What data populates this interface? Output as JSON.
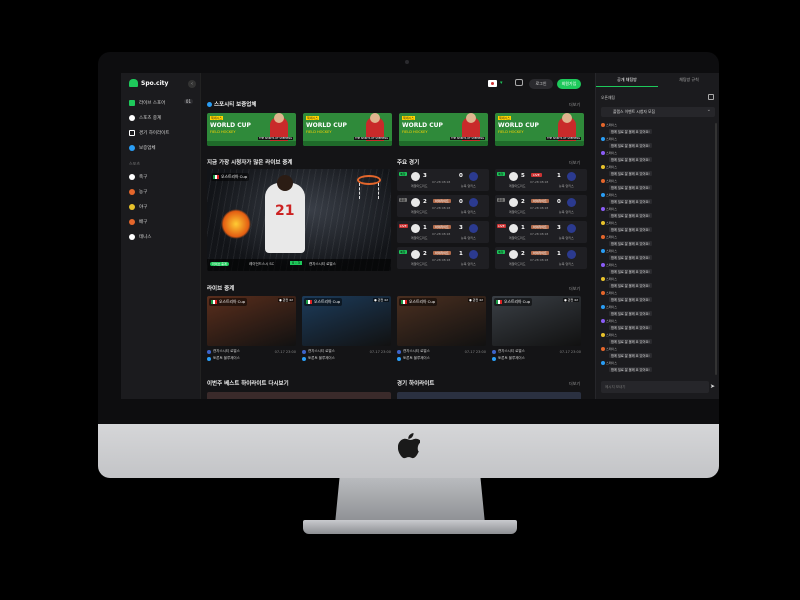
{
  "brand": {
    "name": "Spo.city"
  },
  "header": {
    "login": "로그인",
    "signup": "회원가입"
  },
  "sidebar": {
    "items": [
      {
        "label": "라이브 스포어",
        "badge": "01",
        "color": "#1ec95b"
      },
      {
        "label": "스포츠 중계",
        "color": "#ffffff"
      },
      {
        "label": "경기 하이라이트",
        "color": "#ffffff"
      },
      {
        "label": "보증업체",
        "color": "#2a9df4"
      }
    ],
    "section": "스포츠",
    "sports": [
      {
        "label": "축구",
        "color": "#ffffff"
      },
      {
        "label": "농구",
        "color": "#e4662b"
      },
      {
        "label": "야구",
        "color": "#e8c22b"
      },
      {
        "label": "배구",
        "color": "#e4662b"
      },
      {
        "label": "테니스",
        "color": "#ffffff"
      }
    ]
  },
  "sections": {
    "partners": "스포시티 보증업체",
    "hero": "지금 가장 시청자가 많은 라이브 중계",
    "matches": "주요 경기",
    "live": "라이브 중계",
    "weekly": "이번주 베스트 하이라이트 다시보기",
    "highlights": "경기 하이라이트",
    "more": "더보기"
  },
  "banners": [
    {
      "tag": "제네시스",
      "title": "WORLD CUP",
      "sub": "FIELD HOCKEY",
      "foot": "THE SPIRITS OF SHEEPING"
    },
    {
      "tag": "제네시스",
      "title": "WORLD CUP",
      "sub": "FIELD HOCKEY",
      "foot": "THE SPIRITS OF SHEEPING"
    },
    {
      "tag": "제네시스",
      "title": "WORLD CUP",
      "sub": "FIELD HOCKEY",
      "foot": "THE SPIRITS OF SHEEPING"
    },
    {
      "tag": "제네시스",
      "title": "WORLD CUP",
      "sub": "FIELD HOCKEY",
      "foot": "THE SPIRITS OF SHEEPING"
    }
  ],
  "hero": {
    "cup": "오스트리아 Cup",
    "live": "라이브 중계",
    "team_a": "레이던드스시 SC",
    "score": "0 : 3",
    "team_b": "캔자스시티 로열스"
  },
  "matches": [
    {
      "status": "예정",
      "score_a": "3",
      "score_b": "0",
      "time": "07-28 08:18",
      "team_a": "레알마드리드",
      "team_b": "뉴욕 양키스",
      "hl": ""
    },
    {
      "status": "예정",
      "score_a": "5",
      "score_b": "1",
      "time": "07-28 08:18",
      "team_a": "레알마드리드",
      "team_b": "뉴욕 양키스",
      "hl": "LIVE"
    },
    {
      "status": "종료",
      "score_a": "2",
      "score_b": "0",
      "time": "07-28 08:18",
      "team_a": "레알마드리드",
      "team_b": "뉴욕 양키스",
      "hl": "하이라이트"
    },
    {
      "status": "종료",
      "score_a": "2",
      "score_b": "0",
      "time": "07-28 08:18",
      "team_a": "레알마드리드",
      "team_b": "뉴욕 양키스",
      "hl": "하이라이트"
    },
    {
      "status": "LIVE",
      "score_a": "1",
      "score_b": "3",
      "time": "07-28 08:18",
      "team_a": "레알마드리드",
      "team_b": "뉴욕 양키스",
      "hl": "하이라이트"
    },
    {
      "status": "LIVE",
      "score_a": "1",
      "score_b": "3",
      "time": "07-28 08:18",
      "team_a": "레알마드리드",
      "team_b": "뉴욕 양키스",
      "hl": "하이라이트"
    },
    {
      "status": "예정",
      "score_a": "2",
      "score_b": "1",
      "time": "07-28 08:18",
      "team_a": "레알마드리드",
      "team_b": "뉴욕 양키스",
      "hl": "하이라이트"
    },
    {
      "status": "예정",
      "score_a": "2",
      "score_b": "1",
      "time": "07-28 08:18",
      "team_a": "레알마드리드",
      "team_b": "뉴욕 양키스",
      "hl": "하이라이트"
    }
  ],
  "live_cards": [
    {
      "cup": "오스트리아 Cup",
      "viewers": "● 관전 42",
      "team_a": "캔자스시티 로열스",
      "team_b": "토론토 블루제이스",
      "time": "07-17 23:00",
      "bg": "#5a2e1c"
    },
    {
      "cup": "오스트리아 Cup",
      "viewers": "● 관전 42",
      "team_a": "캔자스시티 로열스",
      "team_b": "토론토 블루제이스",
      "time": "07-17 23:00",
      "bg": "#1c3b5a"
    },
    {
      "cup": "오스트리아 Cup",
      "viewers": "● 관전 42",
      "team_a": "캔자스시티 로열스",
      "team_b": "토론토 블루제이스",
      "time": "07-17 23:00",
      "bg": "#4a2f20"
    },
    {
      "cup": "오스트리아 Cup",
      "viewers": "● 관전 42",
      "team_a": "캔자스시티 로열스",
      "team_b": "토론토 블루제이스",
      "time": "07-17 23:00",
      "bg": "#3a3f45"
    }
  ],
  "chat": {
    "tab_chat": "공개 채팅방",
    "tab_rules": "채팅방 규칙",
    "room_label": "오픈채팅",
    "room_select": "플랩스 이벤트 시청자 모집",
    "user": "스페이스",
    "message": "함께 빌로 잘 볼께 요 있어요!",
    "input_placeholder": "메시지 보내기",
    "count": 20
  }
}
